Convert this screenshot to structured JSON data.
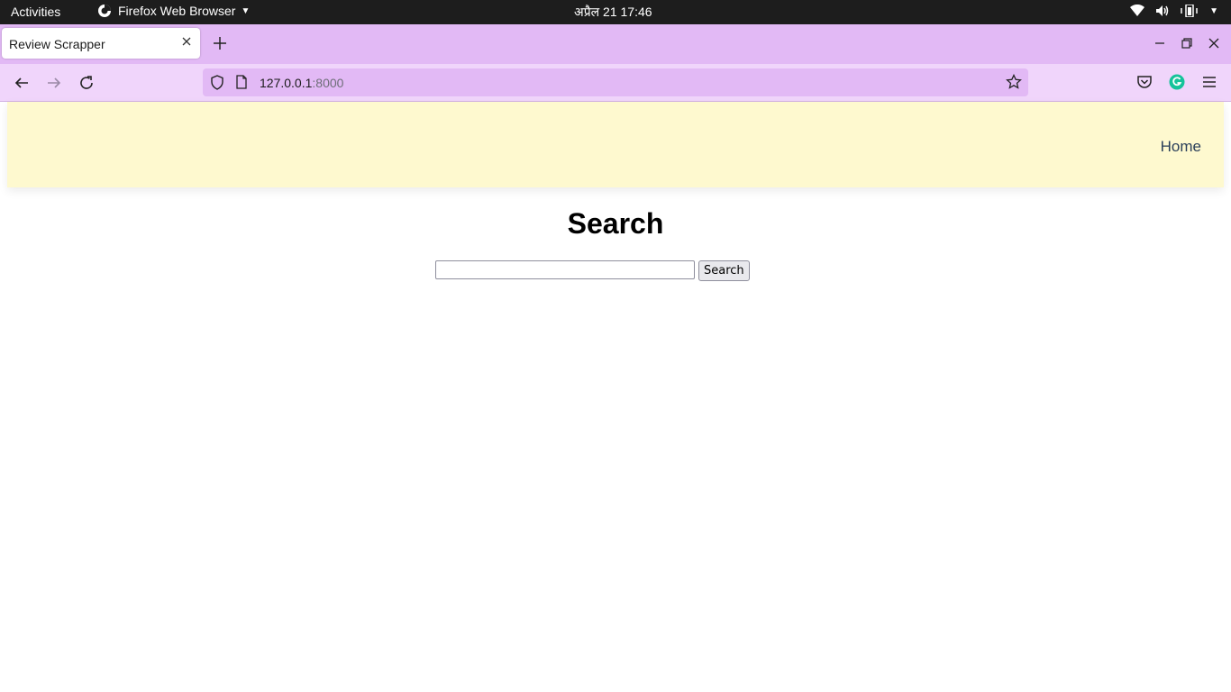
{
  "system_bar": {
    "activities_label": "Activities",
    "app_name": "Firefox Web Browser",
    "clock": "अप्रैल 21  17:46",
    "tray_icons": [
      "wifi-icon",
      "volume-icon",
      "battery-icon"
    ]
  },
  "browser": {
    "tab": {
      "title": "Review Scrapper"
    },
    "address": {
      "host": "127.0.0.1",
      "port": ":8000"
    },
    "toolbar_icons": [
      "back-icon",
      "forward-icon",
      "reload-icon",
      "pocket-icon",
      "grammarly-icon",
      "menu-icon"
    ],
    "accent_colors": {
      "tabstrip": "#e2b9f5",
      "navbar": "#f0d5fb"
    }
  },
  "page": {
    "header": {
      "nav_home": "Home",
      "background": "#fef9cf"
    },
    "heading": "Search",
    "search": {
      "value": "",
      "button_label": "Search"
    }
  }
}
